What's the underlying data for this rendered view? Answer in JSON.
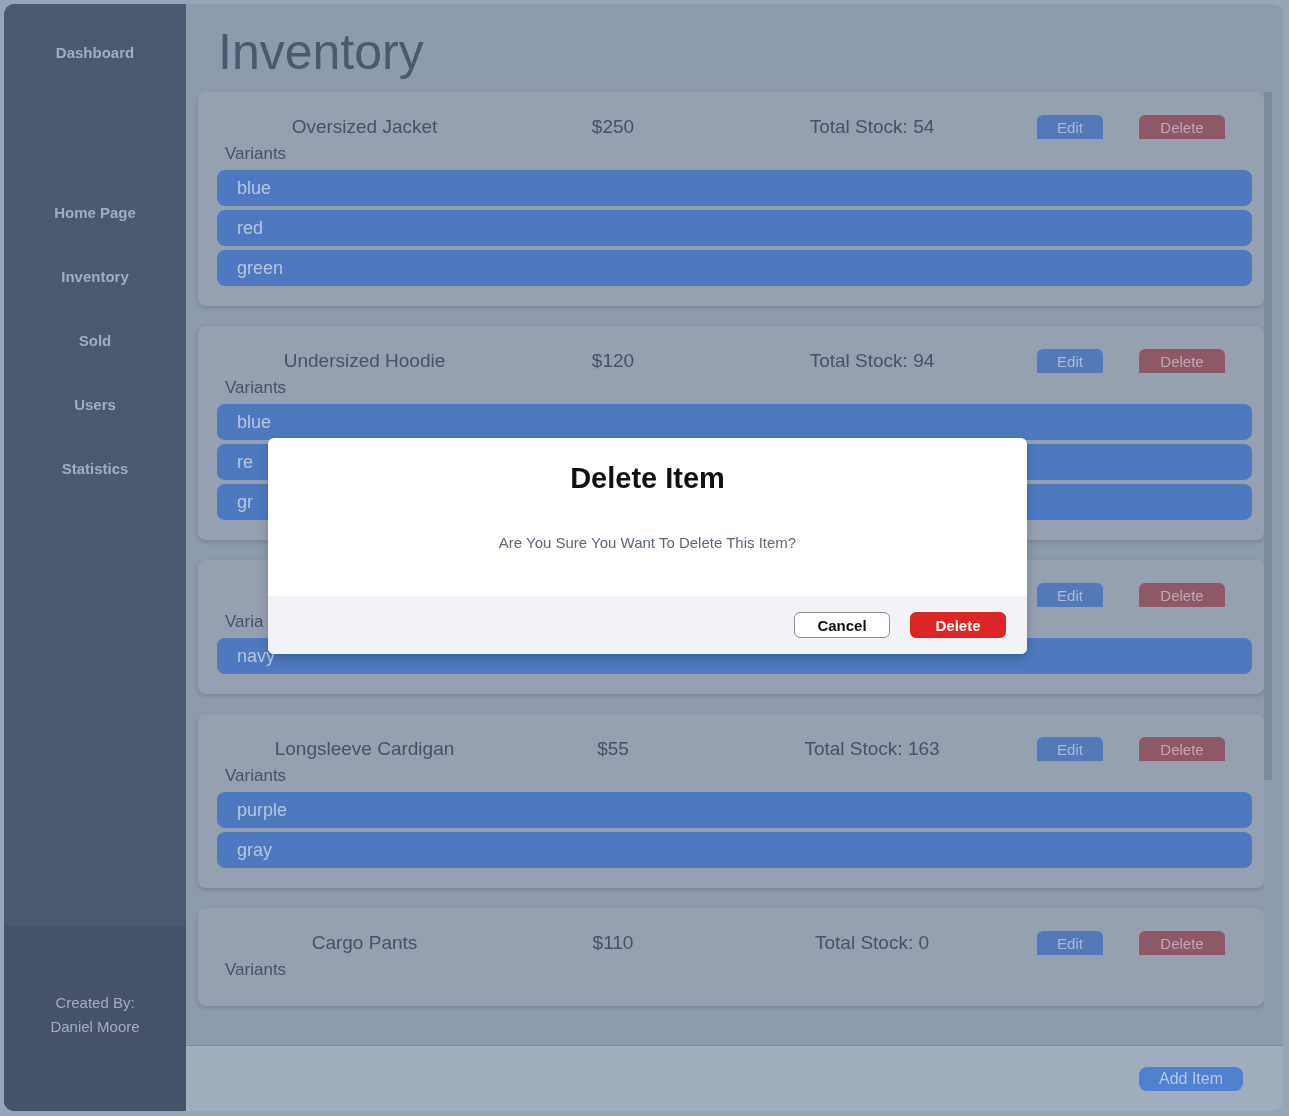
{
  "sidebar": {
    "items": [
      {
        "label": "Dashboard",
        "kind": "heading"
      },
      {
        "label": "Home Page",
        "kind": "link"
      },
      {
        "label": "Inventory",
        "kind": "link"
      },
      {
        "label": "Sold",
        "kind": "link"
      },
      {
        "label": "Users",
        "kind": "link"
      },
      {
        "label": "Statistics",
        "kind": "link"
      }
    ],
    "footer": [
      "Created By:",
      "Daniel Moore"
    ]
  },
  "page": {
    "title": "Inventory"
  },
  "products": [
    {
      "name": "Oversized Jacket",
      "price": "$250",
      "stock": "Total Stock: 54",
      "edit": "Edit",
      "delete": "Delete",
      "variants_label": "Variants",
      "variants": [
        "blue",
        "red",
        "green"
      ]
    },
    {
      "name": "Undersized Hoodie",
      "price": "$120",
      "stock": "Total Stock: 94",
      "edit": "Edit",
      "delete": "Delete",
      "variants_label": "Variants",
      "variants": [
        "blue",
        "re",
        "gr"
      ]
    },
    {
      "edit": "Edit",
      "delete": "Delete",
      "variants_label": "Varia",
      "variants": [
        "navy"
      ]
    },
    {
      "name": "Longsleeve Cardigan",
      "price": "$55",
      "stock": "Total Stock: 163",
      "edit": "Edit",
      "delete": "Delete",
      "variants_label": "Variants",
      "variants": [
        "purple",
        "gray"
      ]
    },
    {
      "name": "Cargo Pants",
      "price": "$110",
      "stock": "Total Stock: 0",
      "edit": "Edit",
      "delete": "Delete",
      "variants_label": "Variants"
    }
  ],
  "footer": {
    "add_button": "Add Item"
  },
  "dialog": {
    "title": "Delete Item",
    "message": "Are You Sure You Want To Delete This Item?",
    "buttons": [
      {
        "label": "Cancel",
        "kind": "secondary"
      },
      {
        "label": "Delete",
        "kind": "danger"
      }
    ]
  }
}
